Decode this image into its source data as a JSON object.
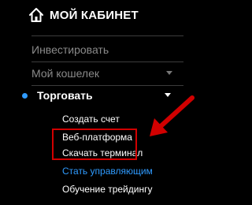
{
  "colors": {
    "background": "#000000",
    "text": "#ffffff",
    "dim_text": "#8a8a8a",
    "accent_link": "#2f9bff",
    "bullet": "#2f9bff",
    "annotation_red": "#d10000"
  },
  "header": {
    "icon": "home-icon",
    "title": "МОЙ КАБИНЕТ"
  },
  "menu": {
    "items": [
      {
        "label": "Инвестировать",
        "state": "dim"
      },
      {
        "label": "Мой кошелек",
        "state": "dim",
        "icon": "chevron-down-icon"
      }
    ],
    "active_section": {
      "label": "Торговать",
      "icon": "chevron-down-icon",
      "bullet_icon": "bullet-dot-icon",
      "sub_items": [
        {
          "label": "Создать счет"
        },
        {
          "label": "Веб-платформа"
        },
        {
          "label": "Скачать терминал"
        },
        {
          "label": "Стать управляющим",
          "accent": true
        },
        {
          "label": "Обучение трейдингу"
        }
      ]
    }
  },
  "annotation": {
    "highlight": "red-highlight-box",
    "arrow": "red-arrow-icon"
  }
}
